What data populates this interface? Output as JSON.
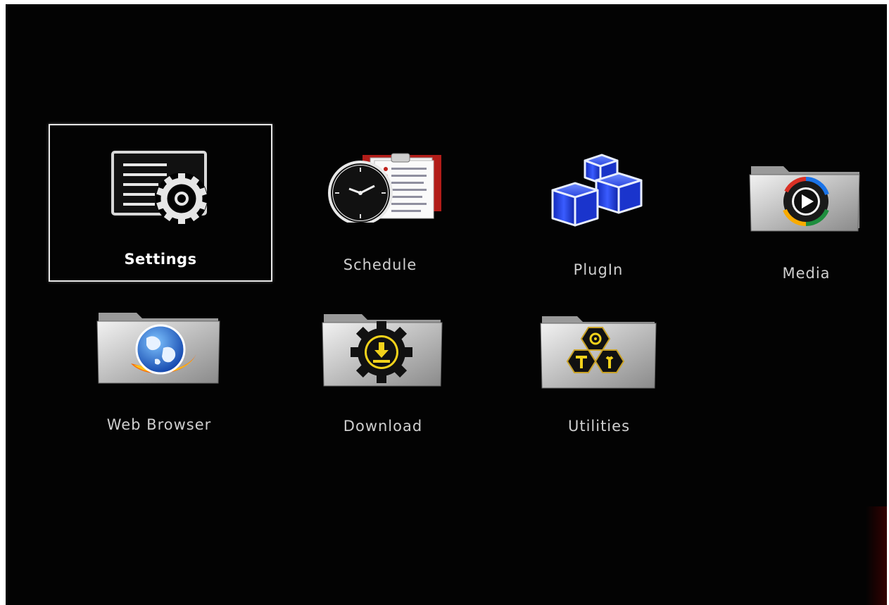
{
  "menu": {
    "items": [
      {
        "id": "settings",
        "label": "Settings",
        "icon": "settings-gear-icon",
        "selected": true
      },
      {
        "id": "schedule",
        "label": "Schedule",
        "icon": "clock-clipboard-icon",
        "selected": false
      },
      {
        "id": "plugin",
        "label": "PlugIn",
        "icon": "cubes-icon",
        "selected": false
      },
      {
        "id": "media",
        "label": "Media",
        "icon": "media-play-folder-icon",
        "selected": false
      },
      {
        "id": "web-browser",
        "label": "Web Browser",
        "icon": "globe-folder-icon",
        "selected": false
      },
      {
        "id": "download",
        "label": "Download",
        "icon": "download-gear-folder-icon",
        "selected": false
      },
      {
        "id": "utilities",
        "label": "Utilities",
        "icon": "tools-folder-icon",
        "selected": false
      }
    ]
  },
  "colors": {
    "background": "#030303",
    "label": "#cfcfcf",
    "selected_border": "#e6e6e6",
    "cube_blue": "#1f3bd6",
    "clipboard_red": "#c0221d",
    "download_yellow": "#f2d21b"
  }
}
